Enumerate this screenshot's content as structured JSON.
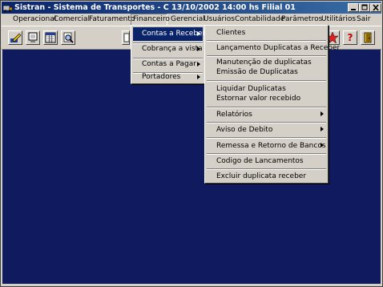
{
  "window": {
    "title": "Sistran - Sistema de Transportes - C  13/10/2002 14:00 hs  Filial 01"
  },
  "menubar": [
    "Operacional",
    "Comercial",
    "Faturamento",
    "Financeiro",
    "Gerencial",
    "Usuários",
    "Contabilidade",
    "Parâmetros",
    "Utilitários",
    "Sair"
  ],
  "financeiro_menu": [
    "Contas a Receber",
    "Cobrança a vista",
    "Contas a Pagar",
    "Portadores"
  ],
  "contas_receber_menu": {
    "clientes": "Clientes",
    "lancamento": "Lançamento Duplicatas a Receber",
    "manutencao": "Manutenção de duplicatas",
    "emissao": "Emissão de Duplicatas",
    "liquidar": "Liquidar Duplicatas",
    "estornar": "Estornar valor recebido",
    "relatorios": "Relatórios",
    "aviso": "Aviso de Debito",
    "remessa": "Remessa e Retorno de Bancos",
    "codigo": "Codigo de Lancamentos",
    "excluir": "Excluir duplicata receber"
  },
  "toolbar": {
    "help_symbol": "?"
  },
  "colors": {
    "workspace": "#0f1b5e",
    "title_bar": "#0a246a",
    "highlight": "#0a246a",
    "face": "#d4d0c8"
  },
  "icons": [
    "app-logo-icon",
    "edit-icon",
    "monitor-icon",
    "calculator-icon",
    "search-icon",
    "help-icon",
    "exit-door-icon",
    "star-icon"
  ]
}
